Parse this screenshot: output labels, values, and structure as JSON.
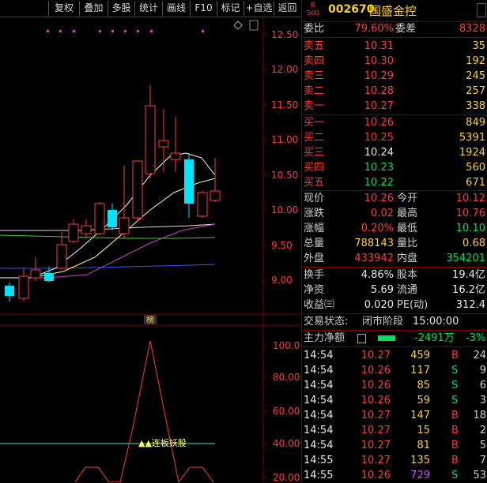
{
  "toolbar": {
    "items": [
      "复权",
      "叠加",
      "多股",
      "统计",
      "画线",
      "F10",
      "标记",
      "+自选",
      "返回"
    ]
  },
  "main_chart": {
    "price_axis": [
      "12.50",
      "12.00",
      "11.50",
      "11.00",
      "10.50",
      "10.00",
      "9.50",
      "9.00"
    ],
    "marker": "榜"
  },
  "indicator": {
    "axis": [
      "100.0",
      "80.00",
      "60.00",
      "40.00",
      "20.00"
    ],
    "signal_text": "▲▲连板妖股"
  },
  "colors": {
    "up": "#ff3b3b",
    "down": "#00e5ff",
    "grid": "#7a0000",
    "ma1": "#ffffff",
    "ma2": "#ffff66",
    "ma3": "#cc44cc",
    "ma4": "#44cc44",
    "ma5": "#3355ff"
  },
  "stock": {
    "r_badge_top": "R",
    "r_badge_bottom": "500",
    "code": "002670",
    "name": "国盛金控"
  },
  "commission": {
    "ratio_label": "委比",
    "ratio": "79.60%",
    "diff_label": "委差",
    "diff": "8328"
  },
  "asks": [
    {
      "label": "卖五",
      "price": "10.31",
      "vol": "35"
    },
    {
      "label": "卖四",
      "price": "10.30",
      "vol": "192"
    },
    {
      "label": "卖三",
      "price": "10.29",
      "vol": "245"
    },
    {
      "label": "卖二",
      "price": "10.28",
      "vol": "257"
    },
    {
      "label": "卖一",
      "price": "10.27",
      "vol": "338"
    }
  ],
  "bids": [
    {
      "label": "买一",
      "price": "10.26",
      "vol": "849"
    },
    {
      "label": "买二",
      "price": "10.25",
      "vol": "5391"
    },
    {
      "label": "买三",
      "price": "10.24",
      "vol": "1924"
    },
    {
      "label": "买四",
      "price": "10.23",
      "vol": "560"
    },
    {
      "label": "买五",
      "price": "10.22",
      "vol": "671"
    }
  ],
  "quote": [
    {
      "l1": "现价",
      "v1": "10.26",
      "l2": "今开",
      "v2": "10.12"
    },
    {
      "l1": "涨跌",
      "v1": "0.02",
      "l2": "最高",
      "v2": "10.76"
    },
    {
      "l1": "涨幅",
      "v1": "0.20%",
      "l2": "最低",
      "v2": "10.10"
    },
    {
      "l1": "总量",
      "v1": "788143",
      "l2": "量比",
      "v2": "0.68"
    },
    {
      "l1": "外盘",
      "v1": "433942",
      "l2": "内盘",
      "v2": "354201"
    }
  ],
  "fund": [
    {
      "l1": "换手",
      "v1": "4.86%",
      "l2": "股本",
      "v2": "19.4亿"
    },
    {
      "l1": "净资",
      "v1": "5.69",
      "l2": "流通",
      "v2": "16.2亿"
    },
    {
      "l1": "收益㈢",
      "v1": "0.020",
      "l2": "PE(动)",
      "v2": "312.4"
    }
  ],
  "status": {
    "label": "交易状态:",
    "value": "闭市阶段",
    "time": "15:00:00"
  },
  "main_force": {
    "label": "主力净额",
    "value": "-2491万",
    "pct": "-3%"
  },
  "ticks": [
    {
      "time": "14:54",
      "price": "10.27",
      "vol": "459",
      "side": "B",
      "n": "24"
    },
    {
      "time": "14:54",
      "price": "10.26",
      "vol": "117",
      "side": "S",
      "n": "9"
    },
    {
      "time": "14:54",
      "price": "10.26",
      "vol": "85",
      "side": "S",
      "n": "6"
    },
    {
      "time": "14:54",
      "price": "10.26",
      "vol": "59",
      "side": "S",
      "n": "3"
    },
    {
      "time": "14:54",
      "price": "10.27",
      "vol": "147",
      "side": "B",
      "n": "18"
    },
    {
      "time": "14:54",
      "price": "10.27",
      "vol": "15",
      "side": "B",
      "n": "2"
    },
    {
      "time": "14:54",
      "price": "10.27",
      "vol": "81",
      "side": "B",
      "n": "5"
    },
    {
      "time": "14:55",
      "price": "10.27",
      "vol": "135",
      "side": "B",
      "n": "7"
    },
    {
      "time": "14:55",
      "price": "10.26",
      "vol": "729",
      "side": "S",
      "n": "53"
    }
  ]
}
